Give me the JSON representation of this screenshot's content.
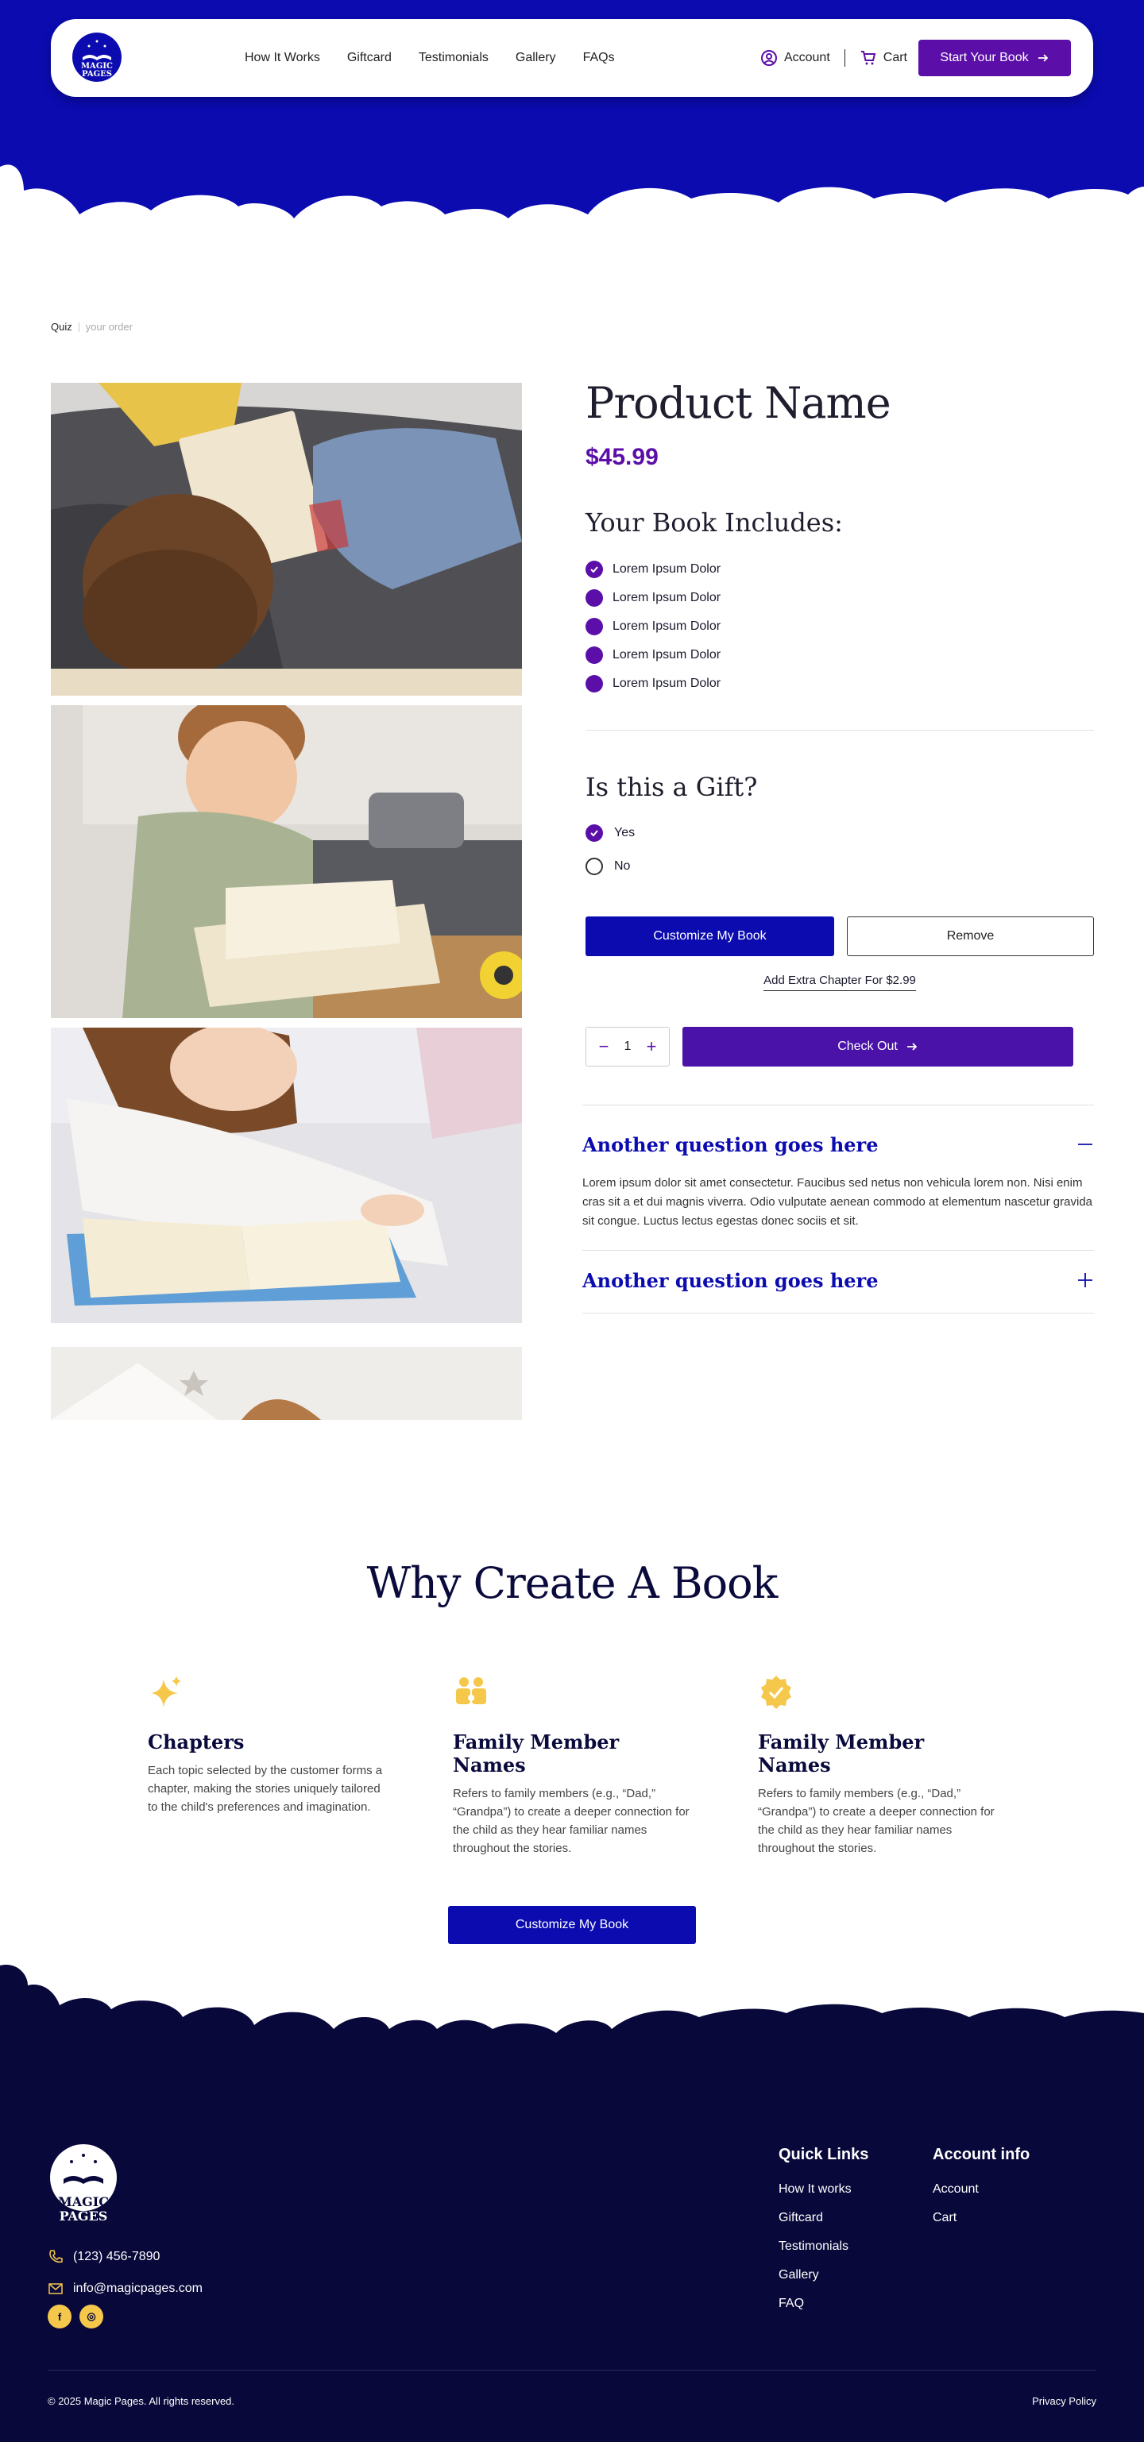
{
  "header": {
    "logo_text": [
      "MAGIC",
      "PAGES"
    ],
    "nav": [
      "How It Works",
      "Giftcard",
      "Testimonials",
      "Gallery",
      "FAQs"
    ],
    "account_label": "Account",
    "cart_label": "Cart",
    "cta_label": "Start Your Book"
  },
  "breadcrumb": {
    "current": "Quiz",
    "next": "your order"
  },
  "product": {
    "title": "Product Name",
    "price": "$45.99",
    "includes_heading": "Your Book Includes:",
    "includes": [
      "Lorem Ipsum Dolor",
      "Lorem Ipsum Dolor",
      "Lorem Ipsum Dolor",
      "Lorem Ipsum Dolor",
      "Lorem Ipsum Dolor"
    ],
    "gift_heading": "Is this a Gift?",
    "gift_options": [
      {
        "label": "Yes",
        "selected": true
      },
      {
        "label": "No",
        "selected": false
      }
    ],
    "customize_label": "Customize My Book",
    "remove_label": "Remove",
    "add_chapter_label": "Add Extra Chapter For $2.99",
    "quantity": "1",
    "checkout_label": "Check Out"
  },
  "faq": [
    {
      "question": "Another question goes here",
      "answer": "Lorem ipsum dolor sit amet consectetur. Faucibus sed netus non vehicula lorem non. Nisi enim cras sit a et dui magnis viverra. Odio vulputate aenean commodo at elementum nascetur gravida sit congue. Luctus lectus egestas donec sociis et sit.",
      "expanded": true
    },
    {
      "question": "Another question goes here",
      "answer": "",
      "expanded": false
    }
  ],
  "why": {
    "heading": "Why Create A Book",
    "features": [
      {
        "icon": "sparkle-icon",
        "title": "Chapters",
        "text": "Each topic selected by the customer forms a chapter, making the stories uniquely tailored to the child's preferences and imagination."
      },
      {
        "icon": "family-icon",
        "title": "Family Member Names",
        "text": "Refers to family members (e.g., “Dad,” “Grandpa”) to create a deeper connection for the child as they hear familiar names throughout the stories."
      },
      {
        "icon": "badge-check-icon",
        "title": "Family Member Names",
        "text": "Refers to family members (e.g., “Dad,” “Grandpa”) to create a deeper connection for the child as they hear familiar names throughout the stories."
      }
    ],
    "cta_label": "Customize My Book"
  },
  "footer": {
    "phone": "(123) 456-7890",
    "email": "info@magicpages.com",
    "quick_links_heading": "Quick Links",
    "quick_links": [
      "How It works",
      "Giftcard",
      "Testimonials",
      "Gallery",
      "FAQ"
    ],
    "account_heading": "Account info",
    "account_links": [
      "Account",
      "Cart"
    ],
    "social": [
      "f",
      "◎"
    ],
    "copyright": "© 2025 Magic Pages. All rights reserved.",
    "privacy": "Privacy Policy"
  },
  "colors": {
    "brand_blue": "#0b0bb0",
    "brand_purple": "#5b0fa8",
    "navy": "#08083a",
    "accent_yellow": "#f5c84c"
  }
}
